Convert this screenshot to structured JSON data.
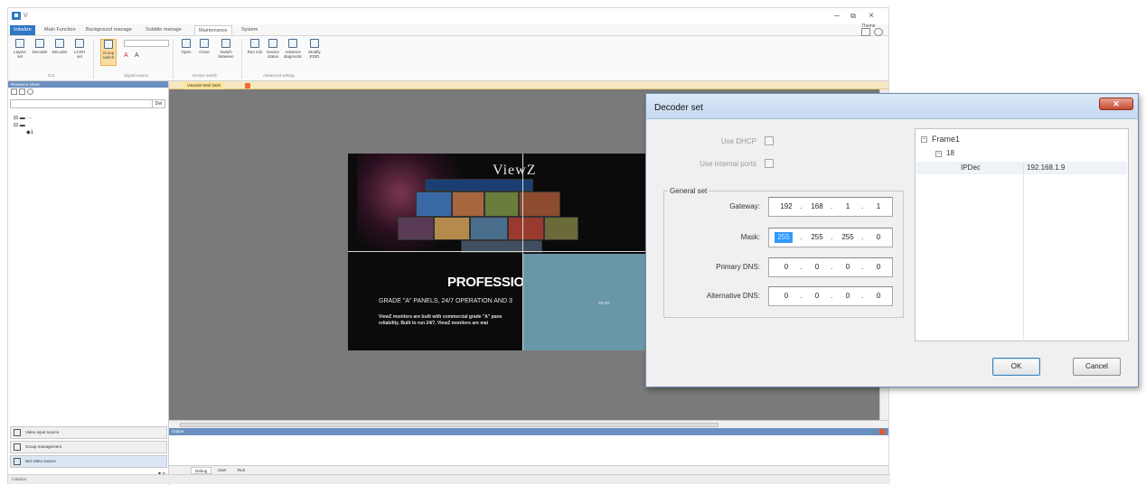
{
  "app": {
    "title": "V",
    "menu_tabs": [
      "Initialize",
      "Main Function",
      "Background manage",
      "Subtitle manage",
      "Maintenance",
      "System"
    ],
    "active_tab_index": 4,
    "theme_label": "Theme",
    "ribbon_groups": [
      {
        "label": "Cut",
        "buttons": [
          "Layers set",
          "Decoder",
          "Decoder",
          "LCDH set"
        ]
      },
      {
        "label": "Signal source",
        "buttons": [
          "Group switch"
        ]
      },
      {
        "label": "Device switch",
        "buttons": [
          "Open",
          "Close",
          "Switch between"
        ]
      },
      {
        "label": "Advanced setting",
        "buttons": [
          "Run info",
          "Device status",
          "Advance diagnostic",
          "Modify EDID"
        ]
      }
    ]
  },
  "left_panel": {
    "header": "Resource share",
    "delete_label": "Del",
    "bottom_nav": [
      {
        "label": "Video input source",
        "selected": false
      },
      {
        "label": "Group management",
        "selected": false
      },
      {
        "label": "Net video source",
        "selected": true
      }
    ]
  },
  "view_tab": {
    "label": "View1M  Wall 1920"
  },
  "output": {
    "header": "Output",
    "tabs": [
      "Debug",
      "User",
      "Run"
    ],
    "selected_tab_index": 0
  },
  "status": {
    "text": "Initialize"
  },
  "wall": {
    "brand": "ViewZ",
    "headline": "PROFESSIONA",
    "subline": "GRADE \"A\" PANELS, 24/7 OPERATION AND 3",
    "copy": "ViewZ monitors are built with commercial grade \"A\" pane reliability. Built to run 24/7, ViewZ monitors are mai",
    "teal_label": "Win02"
  },
  "dialog": {
    "title": "Decoder set",
    "use_dhcp_label": "Use DHCP",
    "use_dhcp_checked": false,
    "use_internal_port_label": "Use internal ports",
    "use_internal_port_checked": false,
    "general_set_label": "General set",
    "fields": [
      {
        "label": "Gateway:",
        "segments": [
          "192",
          "168",
          "1",
          "1"
        ],
        "selected_segment": -1
      },
      {
        "label": "Mask:",
        "segments": [
          "255",
          "255",
          "255",
          "0"
        ],
        "selected_segment": 0
      },
      {
        "label": "Primary DNS:",
        "segments": [
          "0",
          "0",
          "0",
          "0"
        ],
        "selected_segment": -1
      },
      {
        "label": "Alternative DNS:",
        "segments": [
          "0",
          "0",
          "0",
          "0"
        ],
        "selected_segment": -1
      }
    ],
    "tree": {
      "root": "Frame1",
      "child": "18",
      "leaf_name": "IPDec",
      "leaf_value": "192.168.1.9"
    },
    "ok_label": "OK",
    "cancel_label": "Cancel"
  }
}
